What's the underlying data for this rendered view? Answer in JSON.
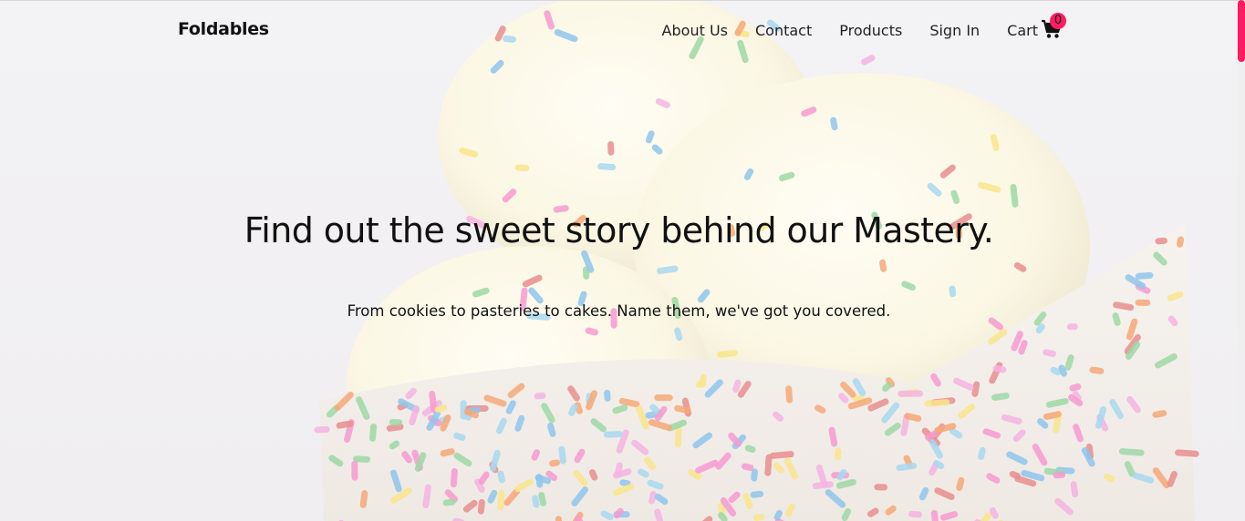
{
  "navbar": {
    "brand": "Foldables",
    "links": [
      "About Us",
      "Contact",
      "Products",
      "Sign In"
    ],
    "cart_label": "Cart",
    "cart_count": "0",
    "cart_icon": "shopping-cart-icon"
  },
  "hero": {
    "title": "Find out the sweet story behind our Mastery.",
    "subtitle": "From cookies to pasteries to cakes. Name them, we've got you covered."
  },
  "colors": {
    "accent": "#ff1c63",
    "text": "#111111",
    "background": "#f1eff1"
  }
}
